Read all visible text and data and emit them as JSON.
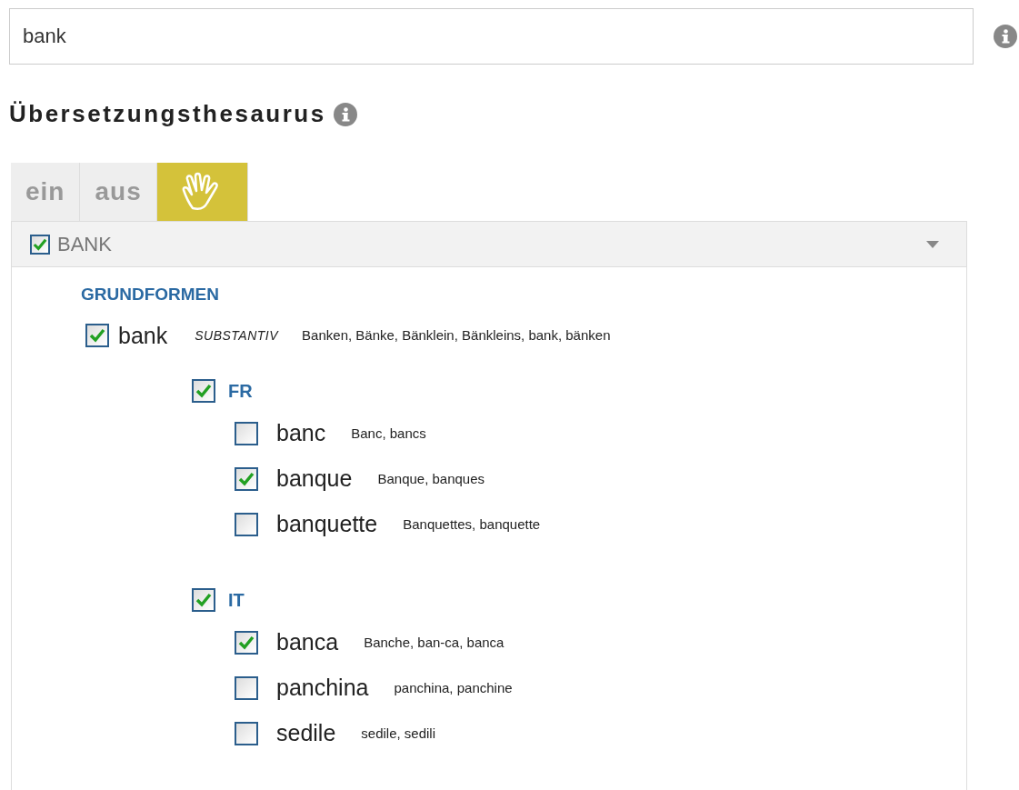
{
  "search": {
    "value": "bank"
  },
  "heading": "Übersetzungsthesaurus",
  "tabs": [
    {
      "kind": "text",
      "label": "ein",
      "selected": false
    },
    {
      "kind": "text",
      "label": "aus",
      "selected": false
    },
    {
      "kind": "icon",
      "selected": true
    }
  ],
  "panel": {
    "checked": true,
    "title": "BANK",
    "expanded": true,
    "section": "GRUNDFORMEN",
    "entries": [
      {
        "word": "bank",
        "checked": true,
        "pos": "SUBSTANTIV",
        "forms": "Banken, Bänke, Bänklein, Bänkleins, bank, bänken",
        "children": [
          {
            "label": "FR",
            "checked": true,
            "children": [
              {
                "word": "banc",
                "checked": false,
                "forms": "Banc, bancs"
              },
              {
                "word": "banque",
                "checked": true,
                "forms": "Banque, banques"
              },
              {
                "word": "banquette",
                "checked": false,
                "forms": "Banquettes, banquette"
              }
            ]
          },
          {
            "label": "IT",
            "checked": true,
            "children": [
              {
                "word": "banca",
                "checked": true,
                "forms": "Banche, ban-ca, banca"
              },
              {
                "word": "panchina",
                "checked": false,
                "forms": "panchina, panchine"
              },
              {
                "word": "sedile",
                "checked": false,
                "forms": "sedile, sedili"
              }
            ]
          }
        ]
      }
    ]
  }
}
